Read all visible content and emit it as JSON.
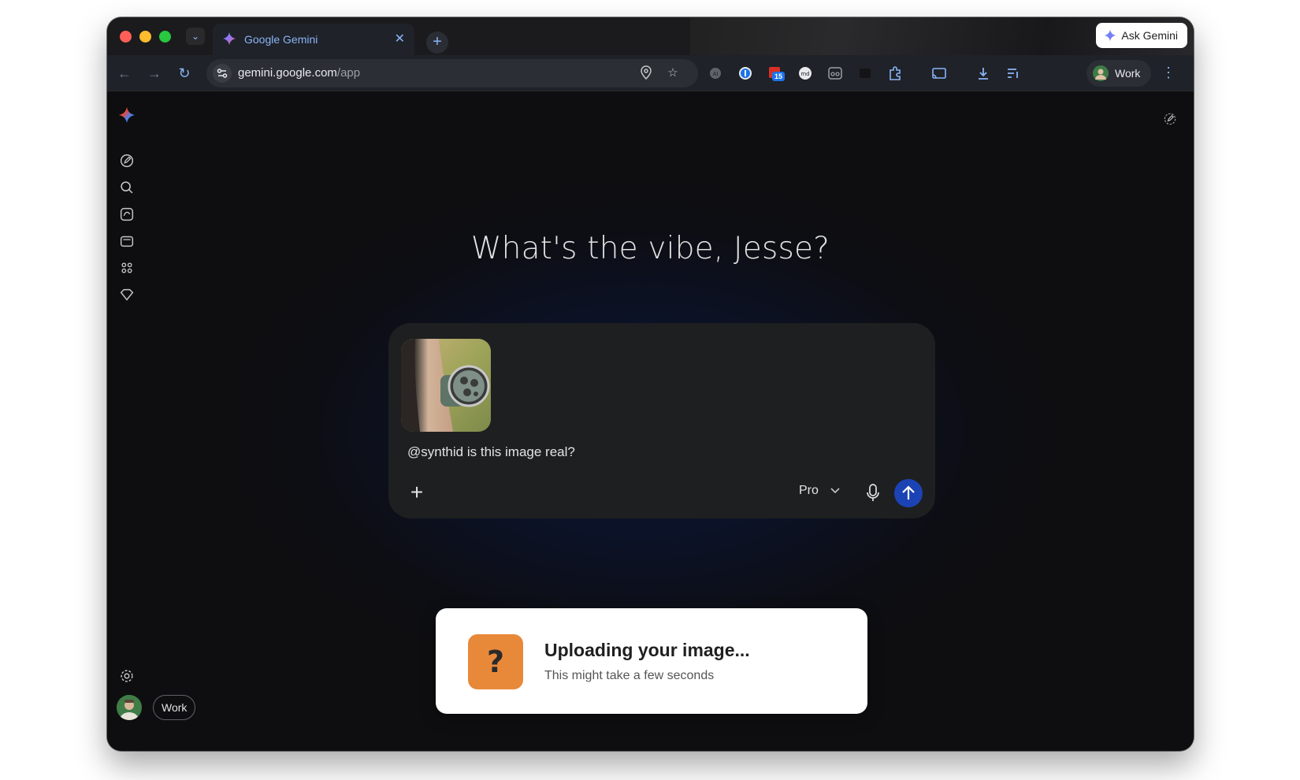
{
  "browser": {
    "tab_title": "Google Gemini",
    "ask_gemini_label": "Ask Gemini",
    "url_host": "gemini.google.com",
    "url_path": "/app",
    "profile_label": "Work",
    "extension_badge": "15"
  },
  "app": {
    "greeting": "What's the vibe, Jesse?",
    "composer": {
      "prompt_text": "@synthid is this image real?",
      "model_label": "Pro"
    },
    "account_label": "Work"
  },
  "toast": {
    "title": "Uploading your image...",
    "subtitle": "This might take a few seconds",
    "icon_glyph": "?"
  },
  "colors": {
    "accent": "#8ab4f8",
    "send_button": "#1b43b4",
    "toast_icon_bg": "#e8893a"
  }
}
